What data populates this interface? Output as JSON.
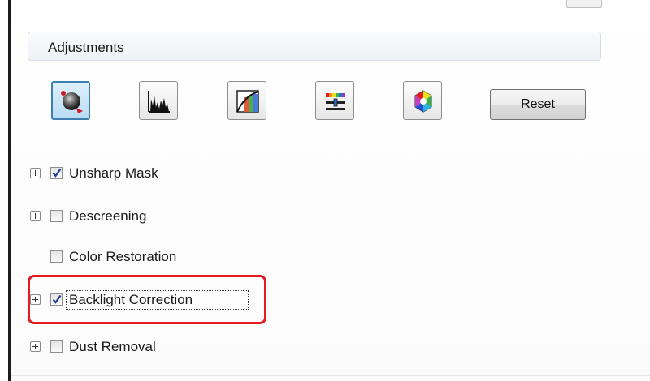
{
  "adjustments": {
    "title": "Adjustments",
    "tools": [
      {
        "name": "auto-exposure",
        "icon": "auto-exposure-icon",
        "active": true
      },
      {
        "name": "histogram-adjustment",
        "icon": "histogram-icon",
        "active": false
      },
      {
        "name": "tone-correction",
        "icon": "tone-curve-icon",
        "active": false
      },
      {
        "name": "image-adjustment",
        "icon": "color-sliders-icon",
        "active": false
      },
      {
        "name": "color-palette",
        "icon": "color-wheel-icon",
        "active": false
      }
    ],
    "reset_label": "Reset",
    "options": [
      {
        "label": "Unsharp Mask",
        "checked": true,
        "expandable": true
      },
      {
        "label": "Descreening",
        "checked": false,
        "expandable": true
      },
      {
        "label": "Color Restoration",
        "checked": false,
        "expandable": false
      },
      {
        "label": "Backlight Correction",
        "checked": true,
        "expandable": true,
        "focused": true,
        "highlighted": true
      },
      {
        "label": "Dust Removal",
        "checked": false,
        "expandable": true
      }
    ]
  },
  "colors": {
    "highlight": "#e31b23",
    "active_button_border": "#3c7fb1",
    "checkmark": "#1f3f8f"
  }
}
